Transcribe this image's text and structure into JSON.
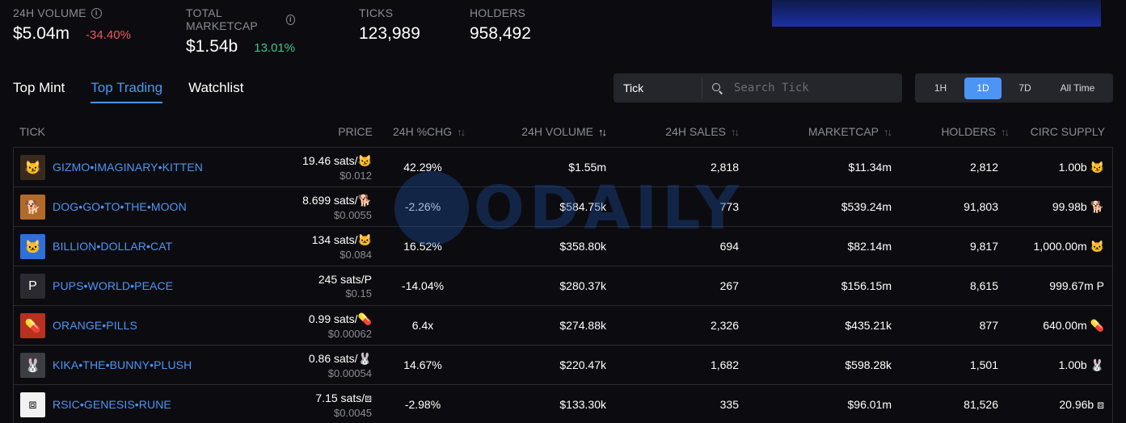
{
  "stats": {
    "volume": {
      "label": "24H VOLUME",
      "value": "$5.04m",
      "change": "-34.40%"
    },
    "marketcap": {
      "label": "TOTAL MARKETCAP",
      "value": "$1.54b",
      "change": "13.01%"
    },
    "ticks": {
      "label": "TICKS",
      "value": "123,989"
    },
    "holders": {
      "label": "HOLDERS",
      "value": "958,492"
    }
  },
  "tabs": [
    "Top Mint",
    "Top Trading",
    "Watchlist"
  ],
  "active_tab": "Top Trading",
  "search": {
    "select_value": "Tick",
    "placeholder": "Search Tick"
  },
  "time_range": {
    "options": [
      "1H",
      "1D",
      "7D",
      "All Time"
    ],
    "selected": "1D"
  },
  "table": {
    "headers": [
      "TICK",
      "PRICE",
      "24H %CHG",
      "24H VOLUME",
      "24H SALES",
      "MARKETCAP",
      "HOLDERS",
      "CIRC SUPPLY"
    ],
    "rows": [
      {
        "tick": "GIZMO•IMAGINARY•KITTEN",
        "symbol": "😼",
        "price_sats": "19.46 sats/😼",
        "price_usd": "$0.012",
        "change": "42.29%",
        "volume": "$1.55m",
        "sales": "2,818",
        "marketcap": "$11.34m",
        "holders": "2,812",
        "supply": "1.00b 😼",
        "avatar_color": "#3a2a1e"
      },
      {
        "tick": "DOG•GO•TO•THE•MOON",
        "symbol": "🐕",
        "price_sats": "8.699 sats/🐕",
        "price_usd": "$0.0055",
        "change": "-2.26%",
        "volume": "$584.75k",
        "sales": "773",
        "marketcap": "$539.24m",
        "holders": "91,803",
        "supply": "99.98b 🐕",
        "avatar_color": "#b26a2a"
      },
      {
        "tick": "BILLION•DOLLAR•CAT",
        "symbol": "🐱",
        "price_sats": "134 sats/🐱",
        "price_usd": "$0.084",
        "change": "16.52%",
        "volume": "$358.80k",
        "sales": "694",
        "marketcap": "$82.14m",
        "holders": "9,817",
        "supply": "1,000.00m 🐱",
        "avatar_color": "#2f6fd8"
      },
      {
        "tick": "PUPS•WORLD•PEACE",
        "symbol": "P",
        "price_sats": "245 sats/P",
        "price_usd": "$0.15",
        "change": "-14.04%",
        "volume": "$280.37k",
        "sales": "267",
        "marketcap": "$156.15m",
        "holders": "8,615",
        "supply": "999.67m P",
        "avatar_color": "#2a2a30"
      },
      {
        "tick": "ORANGE•PILLS",
        "symbol": "💊",
        "price_sats": "0.99 sats/💊",
        "price_usd": "$0.00062",
        "change": "6.4x",
        "volume": "$274.88k",
        "sales": "2,326",
        "marketcap": "$435.21k",
        "holders": "877",
        "supply": "640.00m 💊",
        "avatar_color": "#b8301f"
      },
      {
        "tick": "KIKA•THE•BUNNY•PLUSH",
        "symbol": "🐰",
        "price_sats": "0.86 sats/🐰",
        "price_usd": "$0.00054",
        "change": "14.67%",
        "volume": "$220.47k",
        "sales": "1,682",
        "marketcap": "$598.28k",
        "holders": "1,501",
        "supply": "1.00b 🐰",
        "avatar_color": "#3d3d44"
      },
      {
        "tick": "RSIC•GENESIS•RUNE",
        "symbol": "⧈",
        "price_sats": "7.15 sats/⧈",
        "price_usd": "$0.0045",
        "change": "-2.98%",
        "volume": "$133.30k",
        "sales": "335",
        "marketcap": "$96.01m",
        "holders": "81,526",
        "supply": "20.96b ⧈",
        "avatar_color": "#f2f2f2"
      }
    ]
  },
  "watermark": "ODAILY",
  "colors": {
    "accent": "#4c95f5",
    "positive": "#3cc68a",
    "negative": "#f0575c",
    "background": "#0c0c10"
  }
}
